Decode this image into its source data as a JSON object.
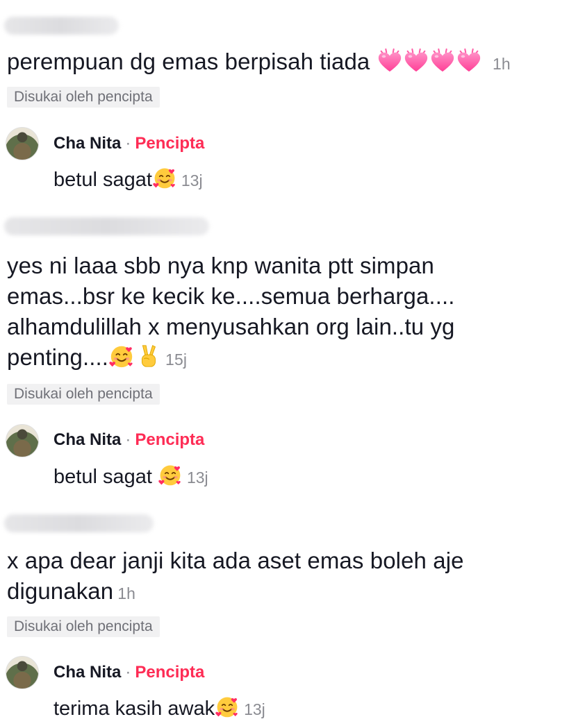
{
  "comments": [
    {
      "text": "perempuan dg emas berpisah tiada",
      "time": "1h",
      "liked_label": "Disukai oleh pencipta",
      "emoji": [
        "sparkling-heart-icon",
        "sparkling-heart-icon",
        "sparkling-heart-icon",
        "sparkling-heart-icon"
      ],
      "reply": {
        "author": "Cha Nita",
        "separator": "·",
        "role": "Pencipta",
        "text": "betul sagat",
        "emoji": [
          "smiling-face-with-hearts-icon"
        ],
        "time": "13j"
      }
    },
    {
      "lines": [
        "yes ni laaa sbb nya knp wanita ptt simpan",
        "emas...bsr ke kecik ke....semua berharga....",
        "alhamdulillah x menyusahkan org lain..tu yg",
        "penting...."
      ],
      "emoji": [
        "smiling-face-with-hearts-icon",
        "victory-hand-icon"
      ],
      "time": "15j",
      "liked_label": "Disukai oleh pencipta",
      "reply": {
        "author": "Cha Nita",
        "separator": "·",
        "role": "Pencipta",
        "text": "betul sagat",
        "emoji": [
          "smiling-face-with-hearts-icon"
        ],
        "time": "13j"
      }
    },
    {
      "lines": [
        "x apa dear janji kita ada aset emas boleh aje",
        "digunakan"
      ],
      "time": "1h",
      "liked_label": "Disukai oleh pencipta",
      "reply": {
        "author": "Cha Nita",
        "separator": "·",
        "role": "Pencipta",
        "text": "terima kasih awak",
        "emoji": [
          "smiling-face-with-hearts-icon"
        ],
        "time": "13j"
      }
    }
  ],
  "colors": {
    "creator_accent": "#fe2c55",
    "muted_text": "#8a8b91",
    "badge_bg": "#f1f1f2",
    "body_text": "#161823"
  }
}
